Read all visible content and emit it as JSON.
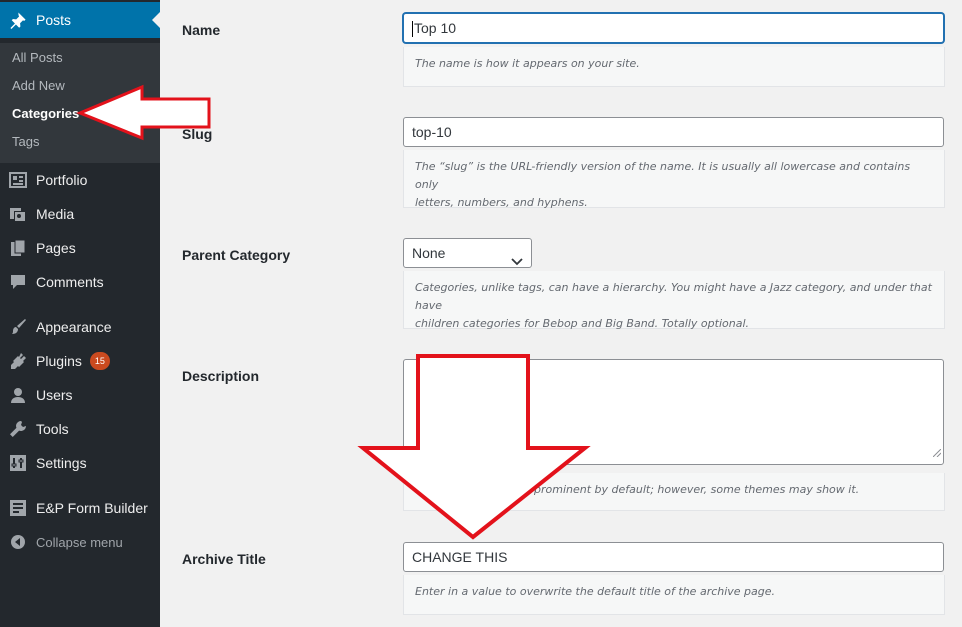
{
  "sidebar": {
    "posts": {
      "label": "Posts",
      "icon": "pushpin-icon"
    },
    "submenu": [
      {
        "label": "All Posts",
        "current": false
      },
      {
        "label": "Add New",
        "current": false
      },
      {
        "label": "Categories",
        "current": true
      },
      {
        "label": "Tags",
        "current": false
      }
    ],
    "portfolio": "Portfolio",
    "media": "Media",
    "pages": "Pages",
    "comments": "Comments",
    "appearance": "Appearance",
    "plugins": "Plugins",
    "plugins_badge": "15",
    "users": "Users",
    "tools": "Tools",
    "settings": "Settings",
    "form_builder": "E&P Form Builder",
    "collapse": "Collapse menu"
  },
  "form": {
    "name": {
      "label": "Name",
      "value": "Top 10",
      "description": "The name is how it appears on your site."
    },
    "slug": {
      "label": "Slug",
      "value": "top-10",
      "description_line1": "The “slug” is the URL-friendly version of the name. It is usually all lowercase and contains only",
      "description_line2": "letters, numbers, and hyphens."
    },
    "parent": {
      "label": "Parent Category",
      "selected": "None",
      "description_line1": "Categories, unlike tags, can have a hierarchy. You might have a Jazz category, and under that have",
      "description_line2": "children categories for Bebop and Big Band. Totally optional."
    },
    "description": {
      "label": "Description",
      "value": "",
      "help": "prominent by default; however, some themes may show it."
    },
    "archive_title": {
      "label": "Archive Title",
      "value": "CHANGE THIS",
      "description": "Enter in a value to overwrite the default title of the archive page."
    }
  },
  "colors": {
    "accent": "#0073aa",
    "sidebar": "#23282d",
    "arrow": "#e3121b",
    "badge": "#ca4a1f"
  }
}
